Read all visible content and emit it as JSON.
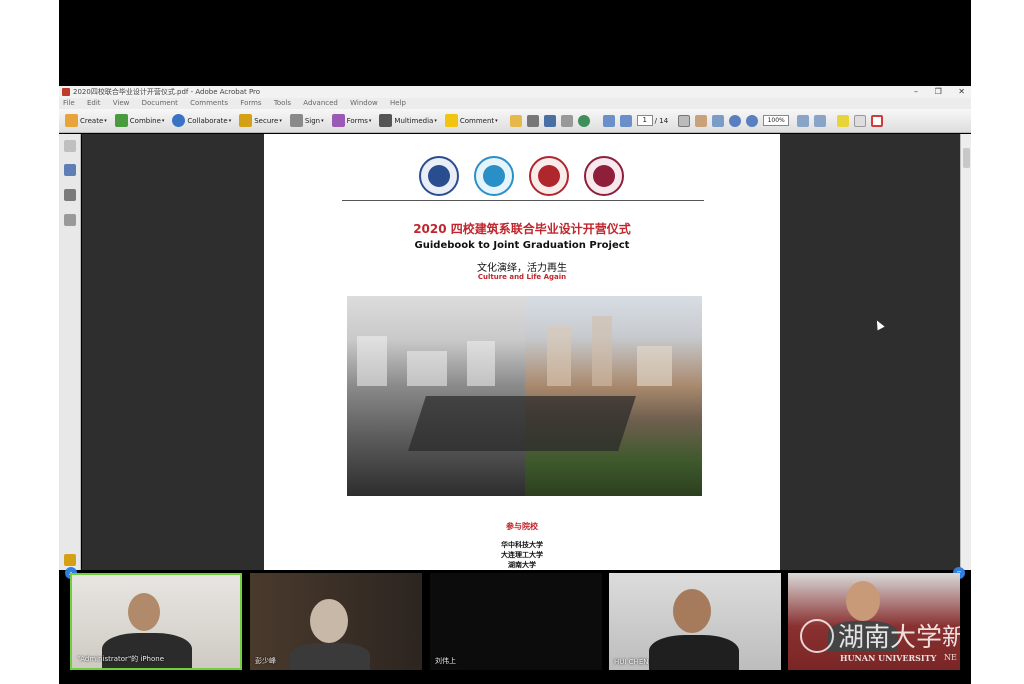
{
  "window": {
    "title": "2020四校联合毕业设计开营仪式.pdf - Adobe Acrobat Pro",
    "controls": [
      "–",
      "❐",
      "✕"
    ]
  },
  "menu": [
    "File",
    "Edit",
    "View",
    "Document",
    "Comments",
    "Forms",
    "Tools",
    "Advanced",
    "Window",
    "Help"
  ],
  "toolbar": {
    "create": "Create",
    "combine": "Combine",
    "collaborate": "Collaborate",
    "secure": "Secure",
    "sign": "Sign",
    "forms": "Forms",
    "multimedia": "Multimedia",
    "comment": "Comment",
    "page_current": "1",
    "page_total": "/ 14",
    "zoom": "100%"
  },
  "document": {
    "title_cn": "2020 四校建筑系联合毕业设计开营仪式",
    "title_en": "Guidebook to Joint Graduation Project",
    "subtitle_cn": "文化演绎，活力再生",
    "subtitle_en": "Culture and Life Again",
    "schools_heading": "参与院校",
    "schools": [
      "华中科技大学",
      "大连理工大学",
      "湖南大学"
    ]
  },
  "participants": [
    {
      "name": "\"Administrator\"的 iPhone"
    },
    {
      "name": "彭少峰"
    },
    {
      "name": "刘伟上"
    },
    {
      "name": "HUI CHEN"
    },
    {
      "name": ""
    }
  ],
  "watermark": {
    "cn": "湖南大学",
    "en": "HUNAN UNIVERSITY",
    "suffix_cn": "新",
    "suffix_en": "NE"
  },
  "colors": {
    "accent_red": "#c0262d",
    "active_speaker": "#6fcf3d",
    "toolbar_bg": "#dedede",
    "workspace_bg": "#2e2e2e"
  }
}
